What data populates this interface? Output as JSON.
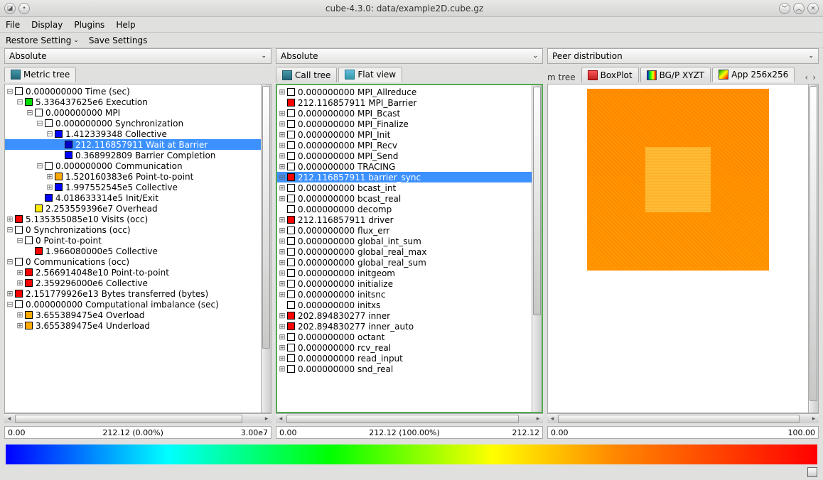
{
  "window": {
    "title": "cube-4.3.0: data/example2D.cube.gz"
  },
  "menu": {
    "file": "File",
    "display": "Display",
    "plugins": "Plugins",
    "help": "Help"
  },
  "toolbar": {
    "restore": "Restore Setting",
    "save": "Save Settings"
  },
  "combo": {
    "left": "Absolute",
    "mid": "Absolute",
    "right": "Peer distribution"
  },
  "tabs": {
    "left": [
      {
        "label": "Metric tree"
      }
    ],
    "mid": [
      {
        "label": "Call tree"
      },
      {
        "label": "Flat view"
      }
    ],
    "right_clipped": "m tree",
    "right": [
      {
        "label": "BoxPlot"
      },
      {
        "label": "BG/P XYZT"
      },
      {
        "label": "App 256x256"
      }
    ]
  },
  "scale": {
    "left": {
      "min": "0.00",
      "mid": "212.12 (0.00%)",
      "max": "3.00e7"
    },
    "mid": {
      "min": "0.00",
      "mid": "212.12 (100.00%)",
      "max": "212.12"
    },
    "right": {
      "min": "0.00",
      "mid": "",
      "max": "100.00"
    }
  },
  "tree_left": [
    {
      "depth": 0,
      "exp": "-",
      "color": "white",
      "label": "0.000000000 Time (sec)"
    },
    {
      "depth": 1,
      "exp": "-",
      "color": "green",
      "label": "5.336437625e6 Execution"
    },
    {
      "depth": 2,
      "exp": "-",
      "color": "white",
      "label": "0.000000000 MPI"
    },
    {
      "depth": 3,
      "exp": "-",
      "color": "white",
      "label": "0.000000000 Synchronization"
    },
    {
      "depth": 4,
      "exp": "-",
      "color": "blue",
      "label": "1.412339348 Collective"
    },
    {
      "depth": 5,
      "exp": "",
      "color": "navy",
      "label": "212.116857911 Wait at Barrier",
      "selected": true
    },
    {
      "depth": 5,
      "exp": "",
      "color": "blue",
      "label": "0.368992809 Barrier Completion"
    },
    {
      "depth": 3,
      "exp": "-",
      "color": "white",
      "label": "0.000000000 Communication"
    },
    {
      "depth": 4,
      "exp": "+",
      "color": "orange",
      "label": "1.520160383e6 Point-to-point"
    },
    {
      "depth": 4,
      "exp": "+",
      "color": "blue",
      "label": "1.997552545e5 Collective"
    },
    {
      "depth": 3,
      "exp": "",
      "color": "blue",
      "label": "4.018633314e5 Init/Exit"
    },
    {
      "depth": 2,
      "exp": "",
      "color": "yellow",
      "label": "2.253559396e7 Overhead"
    },
    {
      "depth": 0,
      "exp": "+",
      "color": "red",
      "label": "5.135355085e10 Visits (occ)"
    },
    {
      "depth": 0,
      "exp": "-",
      "color": "white",
      "label": "0 Synchronizations (occ)"
    },
    {
      "depth": 1,
      "exp": "-",
      "color": "white",
      "label": "0 Point-to-point"
    },
    {
      "depth": 2,
      "exp": "",
      "color": "red",
      "label": "1.966080000e5 Collective"
    },
    {
      "depth": 0,
      "exp": "-",
      "color": "white",
      "label": "0 Communications (occ)"
    },
    {
      "depth": 1,
      "exp": "+",
      "color": "red",
      "label": "2.566914048e10 Point-to-point"
    },
    {
      "depth": 1,
      "exp": "+",
      "color": "red",
      "label": "2.359296000e6 Collective"
    },
    {
      "depth": 0,
      "exp": "+",
      "color": "red",
      "label": "2.151779926e13 Bytes transferred (bytes)"
    },
    {
      "depth": 0,
      "exp": "-",
      "color": "white",
      "label": "0.000000000 Computational imbalance (sec)"
    },
    {
      "depth": 1,
      "exp": "+",
      "color": "orange",
      "label": "3.655389475e4 Overload"
    },
    {
      "depth": 1,
      "exp": "+",
      "color": "orange",
      "label": "3.655389475e4 Underload"
    }
  ],
  "tree_mid": [
    {
      "depth": 0,
      "exp": "+",
      "color": "white",
      "label": "0.000000000 MPI_Allreduce"
    },
    {
      "depth": 0,
      "exp": "",
      "color": "red",
      "label": "212.116857911 MPI_Barrier"
    },
    {
      "depth": 0,
      "exp": "+",
      "color": "white",
      "label": "0.000000000 MPI_Bcast"
    },
    {
      "depth": 0,
      "exp": "+",
      "color": "white",
      "label": "0.000000000 MPI_Finalize"
    },
    {
      "depth": 0,
      "exp": "+",
      "color": "white",
      "label": "0.000000000 MPI_Init"
    },
    {
      "depth": 0,
      "exp": "+",
      "color": "white",
      "label": "0.000000000 MPI_Recv"
    },
    {
      "depth": 0,
      "exp": "+",
      "color": "white",
      "label": "0.000000000 MPI_Send"
    },
    {
      "depth": 0,
      "exp": "+",
      "color": "white",
      "label": "0.000000000 TRACING"
    },
    {
      "depth": 0,
      "exp": "+",
      "color": "red",
      "label": "212.116857911 barrier_sync",
      "selected": true
    },
    {
      "depth": 0,
      "exp": "+",
      "color": "white",
      "label": "0.000000000 bcast_int"
    },
    {
      "depth": 0,
      "exp": "+",
      "color": "white",
      "label": "0.000000000 bcast_real"
    },
    {
      "depth": 0,
      "exp": "",
      "color": "white",
      "label": "0.000000000 decomp"
    },
    {
      "depth": 0,
      "exp": "+",
      "color": "red",
      "label": "212.116857911 driver"
    },
    {
      "depth": 0,
      "exp": "+",
      "color": "white",
      "label": "0.000000000 flux_err"
    },
    {
      "depth": 0,
      "exp": "+",
      "color": "white",
      "label": "0.000000000 global_int_sum"
    },
    {
      "depth": 0,
      "exp": "+",
      "color": "white",
      "label": "0.000000000 global_real_max"
    },
    {
      "depth": 0,
      "exp": "+",
      "color": "white",
      "label": "0.000000000 global_real_sum"
    },
    {
      "depth": 0,
      "exp": "+",
      "color": "white",
      "label": "0.000000000 initgeom"
    },
    {
      "depth": 0,
      "exp": "+",
      "color": "white",
      "label": "0.000000000 initialize"
    },
    {
      "depth": 0,
      "exp": "+",
      "color": "white",
      "label": "0.000000000 initsnc"
    },
    {
      "depth": 0,
      "exp": "",
      "color": "white",
      "label": "0.000000000 initxs"
    },
    {
      "depth": 0,
      "exp": "+",
      "color": "red",
      "label": "202.894830277 inner"
    },
    {
      "depth": 0,
      "exp": "+",
      "color": "red",
      "label": "202.894830277 inner_auto"
    },
    {
      "depth": 0,
      "exp": "+",
      "color": "white",
      "label": "0.000000000 octant"
    },
    {
      "depth": 0,
      "exp": "+",
      "color": "white",
      "label": "0.000000000 rcv_real"
    },
    {
      "depth": 0,
      "exp": "+",
      "color": "white",
      "label": "0.000000000 read_input"
    },
    {
      "depth": 0,
      "exp": "+",
      "color": "white",
      "label": "0.000000000 snd_real"
    }
  ]
}
